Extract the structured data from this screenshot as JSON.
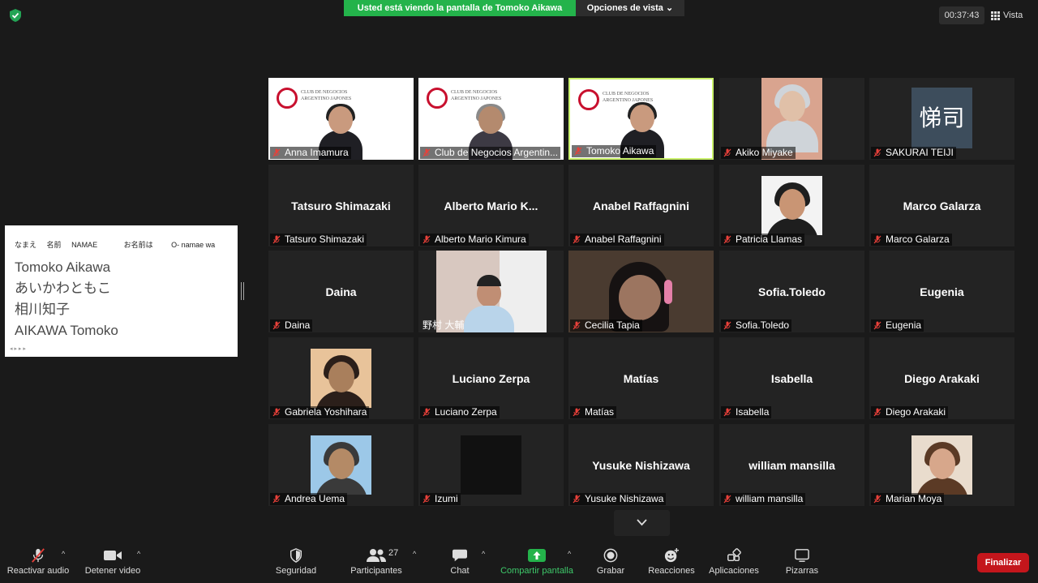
{
  "top": {
    "share_banner": "Usted está viendo la pantalla de Tomoko Aikawa",
    "view_options": "Opciones de vista",
    "timer": "00:37:43",
    "view": "Vista"
  },
  "shared": {
    "header": [
      "なまえ",
      "名前",
      "NAMAE",
      "お名前は",
      "O- namae wa"
    ],
    "lines": [
      "Tomoko Aikawa",
      "あいかわともこ",
      "相川知子",
      "AIKAWA Tomoko"
    ]
  },
  "participants": [
    {
      "name": "Anna Imamura",
      "display": "",
      "kind": "cna"
    },
    {
      "name": "Club de Negocios Argentin...",
      "display": "",
      "kind": "cna"
    },
    {
      "name": "Tomoko Aikawa",
      "display": "",
      "kind": "cna"
    },
    {
      "name": "Akiko Miyake",
      "display": "",
      "kind": "photo"
    },
    {
      "name": "SAKURAI TEIJI",
      "display": "悌司",
      "kind": "avatar"
    },
    {
      "name": "Tatsuro Shimazaki",
      "display": "Tatsuro Shimazaki",
      "kind": "text"
    },
    {
      "name": "Alberto Mario Kimura",
      "display": "Alberto  Mario  K...",
      "kind": "text"
    },
    {
      "name": "Anabel Raffagnini",
      "display": "Anabel Raffagnini",
      "kind": "text"
    },
    {
      "name": "Patricia Llamas",
      "display": "",
      "kind": "photo"
    },
    {
      "name": "Marco Galarza",
      "display": "Marco Galarza",
      "kind": "text"
    },
    {
      "name": "Daina",
      "display": "Daina",
      "kind": "text"
    },
    {
      "name": "野村 大輔",
      "display": "",
      "kind": "video"
    },
    {
      "name": "Cecilia Tapia",
      "display": "",
      "kind": "video"
    },
    {
      "name": "Sofia.Toledo",
      "display": "Sofia.Toledo",
      "kind": "text"
    },
    {
      "name": "Eugenia",
      "display": "Eugenia",
      "kind": "text"
    },
    {
      "name": "Gabriela Yoshihara",
      "display": "",
      "kind": "photo"
    },
    {
      "name": "Luciano Zerpa",
      "display": "Luciano Zerpa",
      "kind": "text"
    },
    {
      "name": "Matías",
      "display": "Matías",
      "kind": "text"
    },
    {
      "name": "Isabella",
      "display": "Isabella",
      "kind": "text"
    },
    {
      "name": "Diego Arakaki",
      "display": "Diego Arakaki",
      "kind": "text"
    },
    {
      "name": "Andrea Uema",
      "display": "",
      "kind": "photo"
    },
    {
      "name": "Izumi",
      "display": "",
      "kind": "black"
    },
    {
      "name": "Yusuke Nishizawa",
      "display": "Yusuke Nishizawa",
      "kind": "text"
    },
    {
      "name": "william mansilla",
      "display": "william mansilla",
      "kind": "text"
    },
    {
      "name": "Marian Moya",
      "display": "",
      "kind": "photo"
    }
  ],
  "cna_brand": {
    "title": "CLUB DE NEGOCIOS ARGENTINO JAPONES",
    "logo": "CNAJ"
  },
  "toolbar": {
    "audio": "Reactivar audio",
    "video": "Detener video",
    "security": "Seguridad",
    "participants": "Participantes",
    "participants_count": "27",
    "chat": "Chat",
    "share": "Compartir pantalla",
    "record": "Grabar",
    "reactions": "Reacciones",
    "apps": "Aplicaciones",
    "whiteboards": "Pizarras",
    "end": "Finalizar"
  },
  "colors": {
    "share_green": "#24b34b",
    "active_border": "#c9f06b",
    "end_red": "#c4161c",
    "muted_red": "#e8403a"
  }
}
